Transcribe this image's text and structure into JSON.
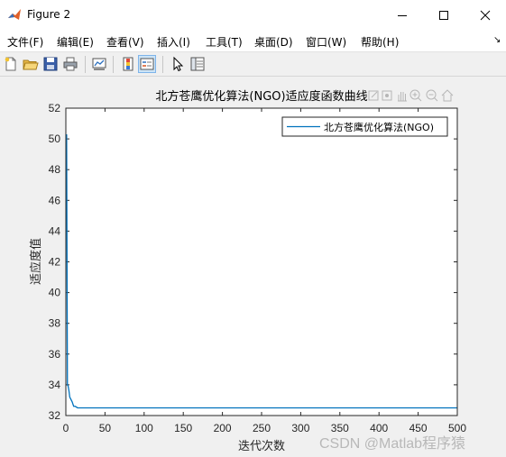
{
  "window": {
    "title": "Figure 2"
  },
  "menu": {
    "items": [
      "文件(F)",
      "编辑(E)",
      "查看(V)",
      "插入(I)",
      "工具(T)",
      "桌面(D)",
      "窗口(W)",
      "帮助(H)"
    ],
    "overflow_glyph": "↘"
  },
  "toolbar": {
    "icons": [
      "new-figure-icon",
      "open-file-icon",
      "save-icon",
      "print-icon",
      "link-plot-icon",
      "insert-colorbar-icon",
      "insert-legend-icon",
      "edit-plot-pointer-icon",
      "property-inspector-icon"
    ]
  },
  "axes_toolbar": {
    "icons": [
      "brush-icon",
      "data-tips-icon",
      "pan-hand-icon",
      "zoom-in-icon",
      "zoom-out-icon",
      "restore-view-home-icon"
    ]
  },
  "chart_data": {
    "type": "line",
    "title": "北方苍鹰优化算法(NGO)适应度函数曲线",
    "xlabel": "迭代次数",
    "ylabel": "适应度值",
    "xlim": [
      0,
      500
    ],
    "ylim": [
      32,
      52
    ],
    "xticks": [
      0,
      50,
      100,
      150,
      200,
      250,
      300,
      350,
      400,
      450,
      500
    ],
    "yticks": [
      32,
      34,
      36,
      38,
      40,
      42,
      44,
      46,
      48,
      50,
      52
    ],
    "grid": false,
    "legend_position": "top-right",
    "series": [
      {
        "name": "北方苍鹰优化算法(NGO)",
        "color": "#0072bd",
        "x": [
          1,
          2,
          3,
          4,
          5,
          8,
          10,
          12,
          15,
          20,
          30,
          50,
          100,
          200,
          300,
          400,
          500
        ],
        "y": [
          50.3,
          34.0,
          33.9,
          33.6,
          33.2,
          32.9,
          32.6,
          32.6,
          32.5,
          32.5,
          32.5,
          32.5,
          32.5,
          32.5,
          32.5,
          32.5,
          32.5
        ]
      }
    ]
  },
  "watermark": "CSDN @Matlab程序猿"
}
